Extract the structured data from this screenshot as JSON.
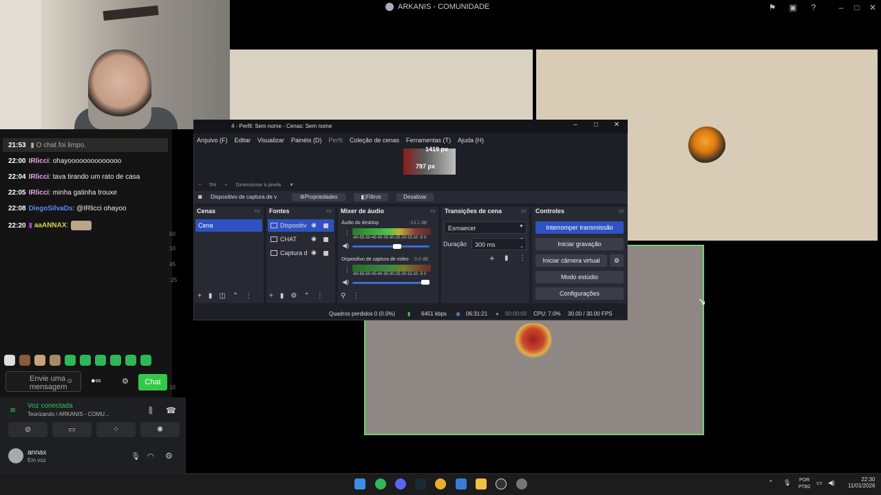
{
  "window": {
    "title": "ARKANIS - COMUNIDADE"
  },
  "chat": {
    "system_time": "21:53",
    "system_text": "O chat foi limpo.",
    "messages": [
      {
        "time": "22:00",
        "user": "IRlicci",
        "text": ": ohayoooooooooooooo"
      },
      {
        "time": "22:04",
        "user": "IRlicci",
        "text": ": tava tirando um rato de casa"
      },
      {
        "time": "22:05",
        "user": "IRlicci",
        "text": ": minha gatinha trouxe"
      },
      {
        "time": "22:08",
        "user": "DiegoSilvaDs",
        "text": ": @IRlicci ohayoo"
      },
      {
        "time": "22:20",
        "user": "aaANNAX",
        "text": ":"
      }
    ],
    "input_placeholder": "Envie uma mensagem",
    "send_label": "Chat",
    "side_numbers": [
      "60",
      "10",
      "45",
      ":25",
      "10"
    ]
  },
  "voice": {
    "status": "Voz conectada",
    "channel": "Teorizando / ARKANIS - COMU...",
    "user_name": "annax",
    "user_status": "Em voz"
  },
  "obs": {
    "title": "4 - Perfil: Sem nome - Cenas: Sem nome",
    "menu": [
      "Arquivo (F)",
      "Editar",
      "Visualizar",
      "Painéis (D)",
      "Perfil",
      "Coleção de cenas",
      "Ferramentas (T)",
      "Ajuda (H)"
    ],
    "preview_w": "1419 px",
    "preview_h": "797 px",
    "zoom": "5%",
    "zoom_mode": "Dimensionar à janela",
    "source_name": "Dispositivo de captura de v",
    "properties": "Propriedades",
    "filters": "Filtros",
    "deactivate": "Desativar",
    "docks": {
      "scenes": "Cenas",
      "sources": "Fontes",
      "mixer": "Mixer de áudio",
      "transitions": "Transições de cena",
      "controls": "Controles"
    },
    "scene_item": "Cena",
    "sources": [
      "Dispositiv",
      "CHAT",
      "Captura d"
    ],
    "mixer": [
      {
        "label": "Áudio do desktop",
        "db": "-13.1 dB"
      },
      {
        "label": "Dispositivo de captura de vídeo",
        "db": "0.0 dB"
      }
    ],
    "meter_ticks": "-60-55-50-45-40-35-30-25-20-15-10 -5 0",
    "transition": "Esmaecer",
    "duration_label": "Duração",
    "duration": "300 ms",
    "controls": [
      "Interromper transmissão",
      "Iniciar gravação",
      "Iniciar câmera virtual",
      "Modo estúdio",
      "Configurações"
    ],
    "status": {
      "dropped": "Quadros perdidos 0 (0.0%)",
      "bitrate": "6451 kbps",
      "stream_time": "06:31:21",
      "rec_time": "00:00:00",
      "cpu": "CPU: 7.0%",
      "fps": "30.00 / 30.00 FPS"
    }
  },
  "taskbar": {
    "lang": "POR",
    "layout": "PTB2",
    "time": "22:30",
    "date": "11/01/2026"
  },
  "colors": {
    "accent": "#2f52c2",
    "chat_green": "#34c84a",
    "voice_green": "#2ec85a"
  }
}
